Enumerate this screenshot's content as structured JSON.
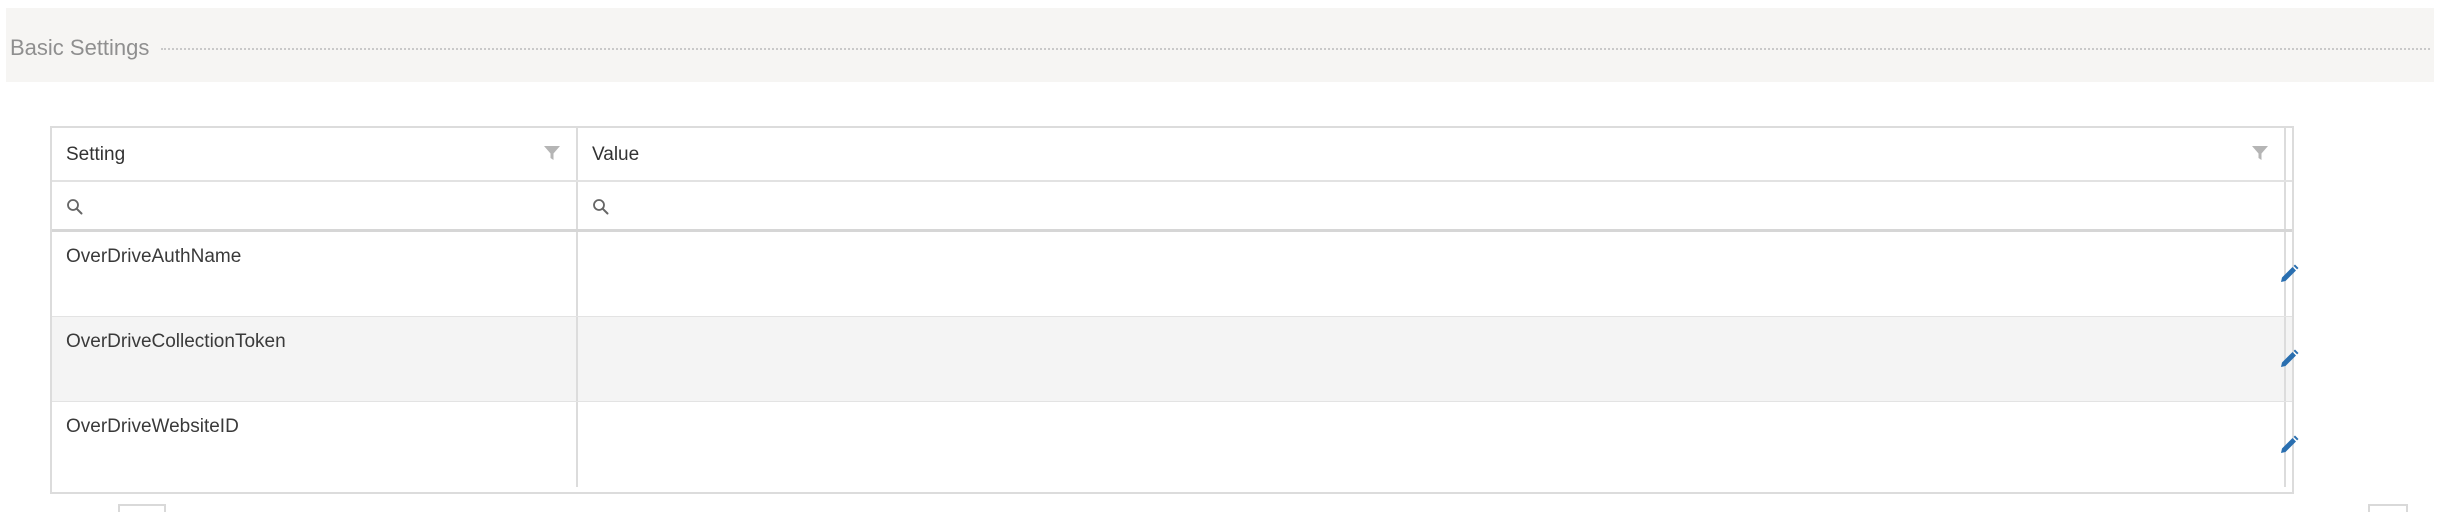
{
  "section": {
    "title": "Basic Settings"
  },
  "grid": {
    "columns": {
      "setting": "Setting",
      "value": "Value"
    },
    "search": {
      "setting_placeholder": "",
      "value_placeholder": ""
    },
    "rows": [
      {
        "setting": "OverDriveAuthName",
        "value": ""
      },
      {
        "setting": "OverDriveCollectionToken",
        "value": ""
      },
      {
        "setting": "OverDriveWebsiteID",
        "value": ""
      }
    ]
  },
  "icons": {
    "filter": "filter-icon",
    "search": "search-icon",
    "edit": "pencil-icon"
  },
  "colors": {
    "accent": "#2a6fb0",
    "filter": "#b5b5b5",
    "alt_row": "#f4f4f4",
    "section_band": "#f6f5f3",
    "section_title": "#8f8f8f"
  }
}
